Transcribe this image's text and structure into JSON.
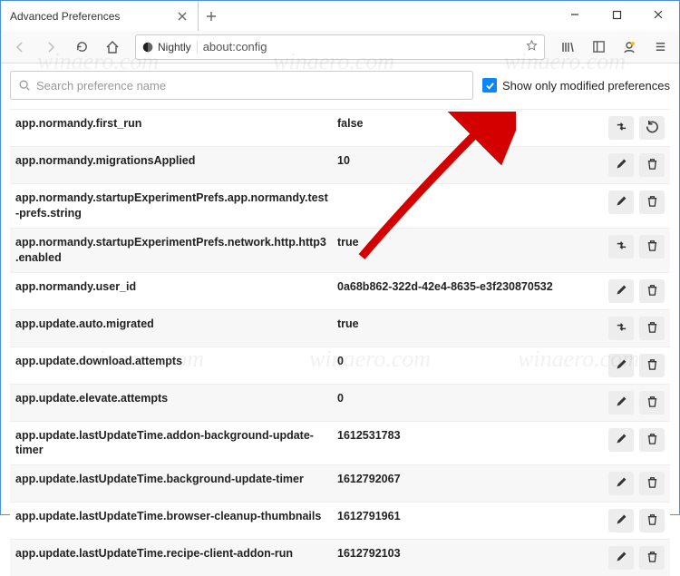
{
  "window": {
    "tab_title": "Advanced Preferences",
    "minimize": "—",
    "maximize": "☐",
    "close": "✕"
  },
  "toolbar": {
    "identity_label": "Nightly",
    "url": "about:config"
  },
  "search": {
    "placeholder": "Search preference name"
  },
  "filter": {
    "show_modified_label": "Show only modified preferences",
    "checked": true
  },
  "prefs": [
    {
      "name": "app.normandy.first_run",
      "value": "false",
      "actions": [
        "toggle",
        "reset"
      ]
    },
    {
      "name": "app.normandy.migrationsApplied",
      "value": "10",
      "actions": [
        "edit",
        "delete"
      ]
    },
    {
      "name": "app.normandy.startupExperimentPrefs.app.normandy.test-prefs.string",
      "value": "",
      "actions": [
        "edit",
        "delete"
      ]
    },
    {
      "name": "app.normandy.startupExperimentPrefs.network.http.http3.enabled",
      "value": "true",
      "actions": [
        "toggle",
        "delete"
      ]
    },
    {
      "name": "app.normandy.user_id",
      "value": "0a68b862-322d-42e4-8635-e3f230870532",
      "actions": [
        "edit",
        "delete"
      ]
    },
    {
      "name": "app.update.auto.migrated",
      "value": "true",
      "actions": [
        "toggle",
        "delete"
      ]
    },
    {
      "name": "app.update.download.attempts",
      "value": "0",
      "actions": [
        "edit",
        "delete"
      ]
    },
    {
      "name": "app.update.elevate.attempts",
      "value": "0",
      "actions": [
        "edit",
        "delete"
      ]
    },
    {
      "name": "app.update.lastUpdateTime.addon-background-update-timer",
      "value": "1612531783",
      "actions": [
        "edit",
        "delete"
      ]
    },
    {
      "name": "app.update.lastUpdateTime.background-update-timer",
      "value": "1612792067",
      "actions": [
        "edit",
        "delete"
      ]
    },
    {
      "name": "app.update.lastUpdateTime.browser-cleanup-thumbnails",
      "value": "1612791961",
      "actions": [
        "edit",
        "delete"
      ]
    },
    {
      "name": "app.update.lastUpdateTime.recipe-client-addon-run",
      "value": "1612792103",
      "actions": [
        "edit",
        "delete"
      ]
    }
  ],
  "watermarks": [
    "winaero.com",
    "winaero.com",
    "winaero.com",
    "winaero.com",
    "winaero.com",
    "winaero.com"
  ]
}
